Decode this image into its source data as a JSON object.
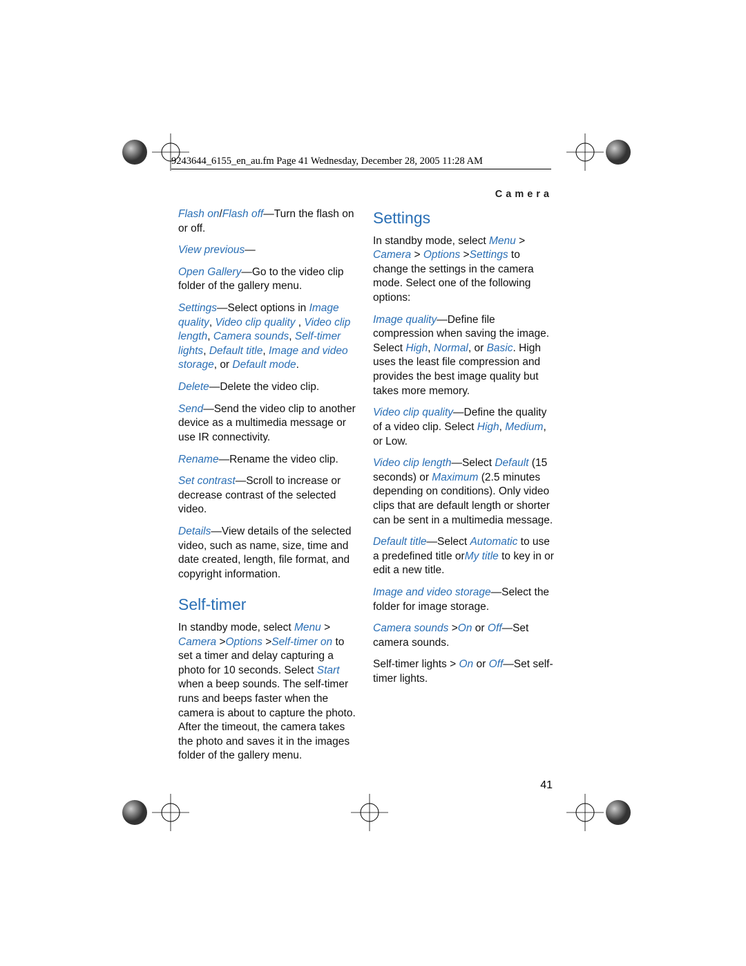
{
  "header": "9243644_6155_en_au.fm  Page 41  Wednesday, December 28, 2005  11:28 AM",
  "section_tag": "Camera",
  "page_num": "41",
  "left": {
    "p1_a": "Flash on",
    "p1_b": "Flash off",
    "p1_c": "—Turn the flash on or off.",
    "p2_a": "View previous",
    "p2_b": "—",
    "p3_a": "Open Gallery",
    "p3_b": "—Go to the video clip folder of the gallery menu.",
    "p4_a": "Settings",
    "p4_b": "—Select options in ",
    "p4_c": "Image quality",
    "p4_d": ", ",
    "p4_e": "Video clip quality ",
    "p4_f": ", ",
    "p4_g": "Video clip length",
    "p4_h": ", ",
    "p4_i": "Camera sounds",
    "p4_j": ", ",
    "p4_k": "Self-timer lights",
    "p4_l": ", ",
    "p4_m": "Default title",
    "p4_n": ", ",
    "p4_o": "Image and video storage",
    "p4_p": ", or ",
    "p4_q": "Default mode",
    "p4_r": ".",
    "p5_a": "Delete",
    "p5_b": "—Delete the video clip.",
    "p6_a": "Send",
    "p6_b": "—Send the video clip to another device as a multimedia message or use IR connectivity.",
    "p7_a": "Rename",
    "p7_b": "—Rename the video clip.",
    "p8_a": "Set contrast",
    "p8_b": "—Scroll to increase or decrease contrast of the selected video.",
    "p9_a": "Details",
    "p9_b": "—View details of the selected video, such as name, size, time and date created, length, file format, and copyright information.",
    "h_selftimer": "Self-timer",
    "p10_a": "In standby mode, select ",
    "p10_b": "Menu",
    "p10_c": " > ",
    "p10_d": "Camera ",
    "p10_e": ">",
    "p10_f": "Options ",
    "p10_g": ">",
    "p10_h": "Self-timer on",
    "p10_i": " to set a timer and delay capturing a photo for 10 seconds. Select ",
    "p10_j": "Start",
    "p10_k": " when a beep sounds. The self-timer runs and beeps faster when the camera is about to capture the photo. After the timeout, the camera takes the photo and saves it in the images folder of the gallery menu."
  },
  "right": {
    "h_settings": "Settings",
    "p1_a": "In standby mode, select ",
    "p1_b": "Menu",
    "p1_c": " > ",
    "p1_d": "Camera",
    "p1_e": " > ",
    "p1_f": "Options ",
    "p1_g": ">",
    "p1_h": "Settings",
    "p1_i": " to change the settings in the camera mode. Select one of the following options:",
    "p2_a": "Image quality",
    "p2_b": "—Define file compression when saving the image. Select ",
    "p2_c": "High",
    "p2_d": ", ",
    "p2_e": "Normal",
    "p2_f": ", or ",
    "p2_g": "Basic",
    "p2_h": ". High uses the least file compression and provides the best image quality but takes more memory.",
    "p3_a": "Video clip quality",
    "p3_b": "—Define the quality of a video clip. Select ",
    "p3_c": "High",
    "p3_d": ", ",
    "p3_e": "Medium",
    "p3_f": ", or Low.",
    "p4_a": "Video clip length",
    "p4_b": "—Select ",
    "p4_c": "Default",
    "p4_d": " (15 seconds) or ",
    "p4_e": "Maximum",
    "p4_f": " (2.5 minutes depending on conditions). Only video clips that are default length or shorter can be sent in a multimedia message.",
    "p5_a": "Default title",
    "p5_b": "—Select ",
    "p5_c": "Automatic",
    "p5_d": " to use a predefined title or",
    "p5_e": "My title",
    "p5_f": " to key in or edit a new title.",
    "p6_a": "Image and video storage",
    "p6_b": "—Select the folder for image storage.",
    "p7_a": "Camera sounds ",
    "p7_b": ">",
    "p7_c": "On",
    "p7_d": " or ",
    "p7_e": "Off",
    "p7_f": "—Set camera sounds.",
    "p8_a": "Self-timer lights > ",
    "p8_b": "On",
    "p8_c": " or ",
    "p8_d": "Off",
    "p8_e": "—Set self-timer lights."
  }
}
